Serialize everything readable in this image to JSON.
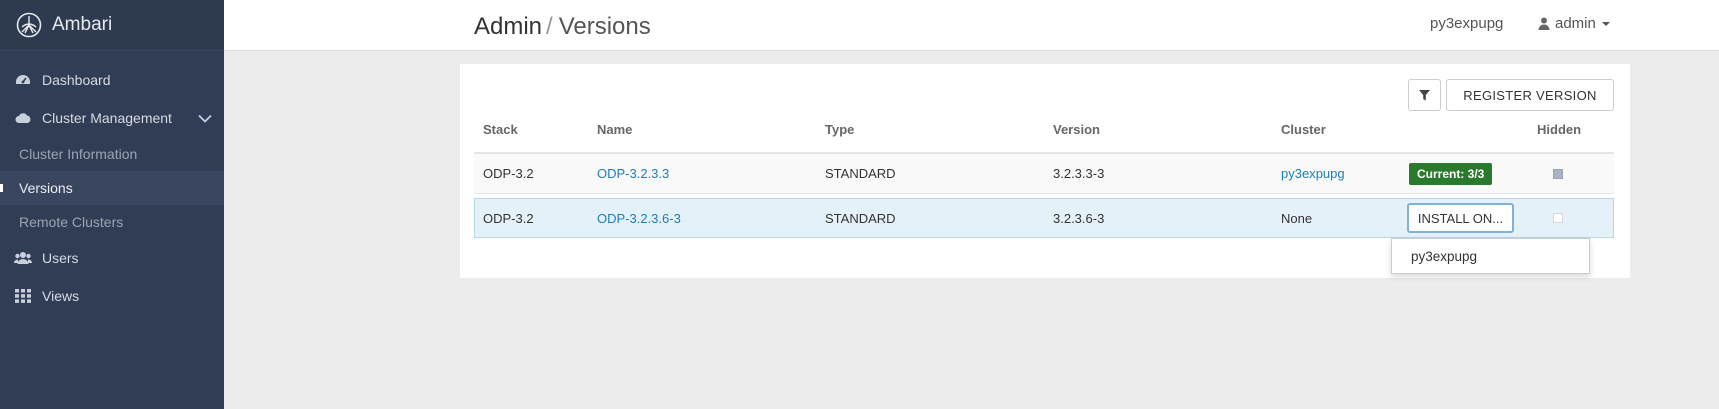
{
  "sidebar": {
    "brand": "Ambari",
    "items": {
      "dashboard": "Dashboard",
      "cluster_management": "Cluster Management",
      "cluster_information": "Cluster Information",
      "versions": "Versions",
      "remote_clusters": "Remote Clusters",
      "users": "Users",
      "views": "Views"
    }
  },
  "header": {
    "breadcrumb_root": "Admin",
    "breadcrumb_separator": "/",
    "breadcrumb_current": "Versions",
    "cluster_name": "py3expupg",
    "user": "admin"
  },
  "toolbar": {
    "register_label": "REGISTER VERSION"
  },
  "table": {
    "columns": {
      "stack": "Stack",
      "name": "Name",
      "type": "Type",
      "version": "Version",
      "cluster": "Cluster",
      "hidden": "Hidden"
    },
    "rows": [
      {
        "stack": "ODP-3.2",
        "name": "ODP-3.2.3.3",
        "type": "STANDARD",
        "version": "3.2.3.3-3",
        "cluster": "py3expupg",
        "status": "Current: 3/3",
        "hidden": true
      },
      {
        "stack": "ODP-3.2",
        "name": "ODP-3.2.3.6-3",
        "type": "STANDARD",
        "version": "3.2.3.6-3",
        "cluster": "None",
        "action": "INSTALL ON...",
        "hidden": false
      }
    ]
  },
  "install_dropdown": {
    "options": [
      "py3expupg"
    ]
  },
  "colors": {
    "sidebar_bg": "#313d54",
    "link": "#1f7eb6",
    "badge_green": "#2a7a2d",
    "selected_row": "#e4f1f8"
  }
}
